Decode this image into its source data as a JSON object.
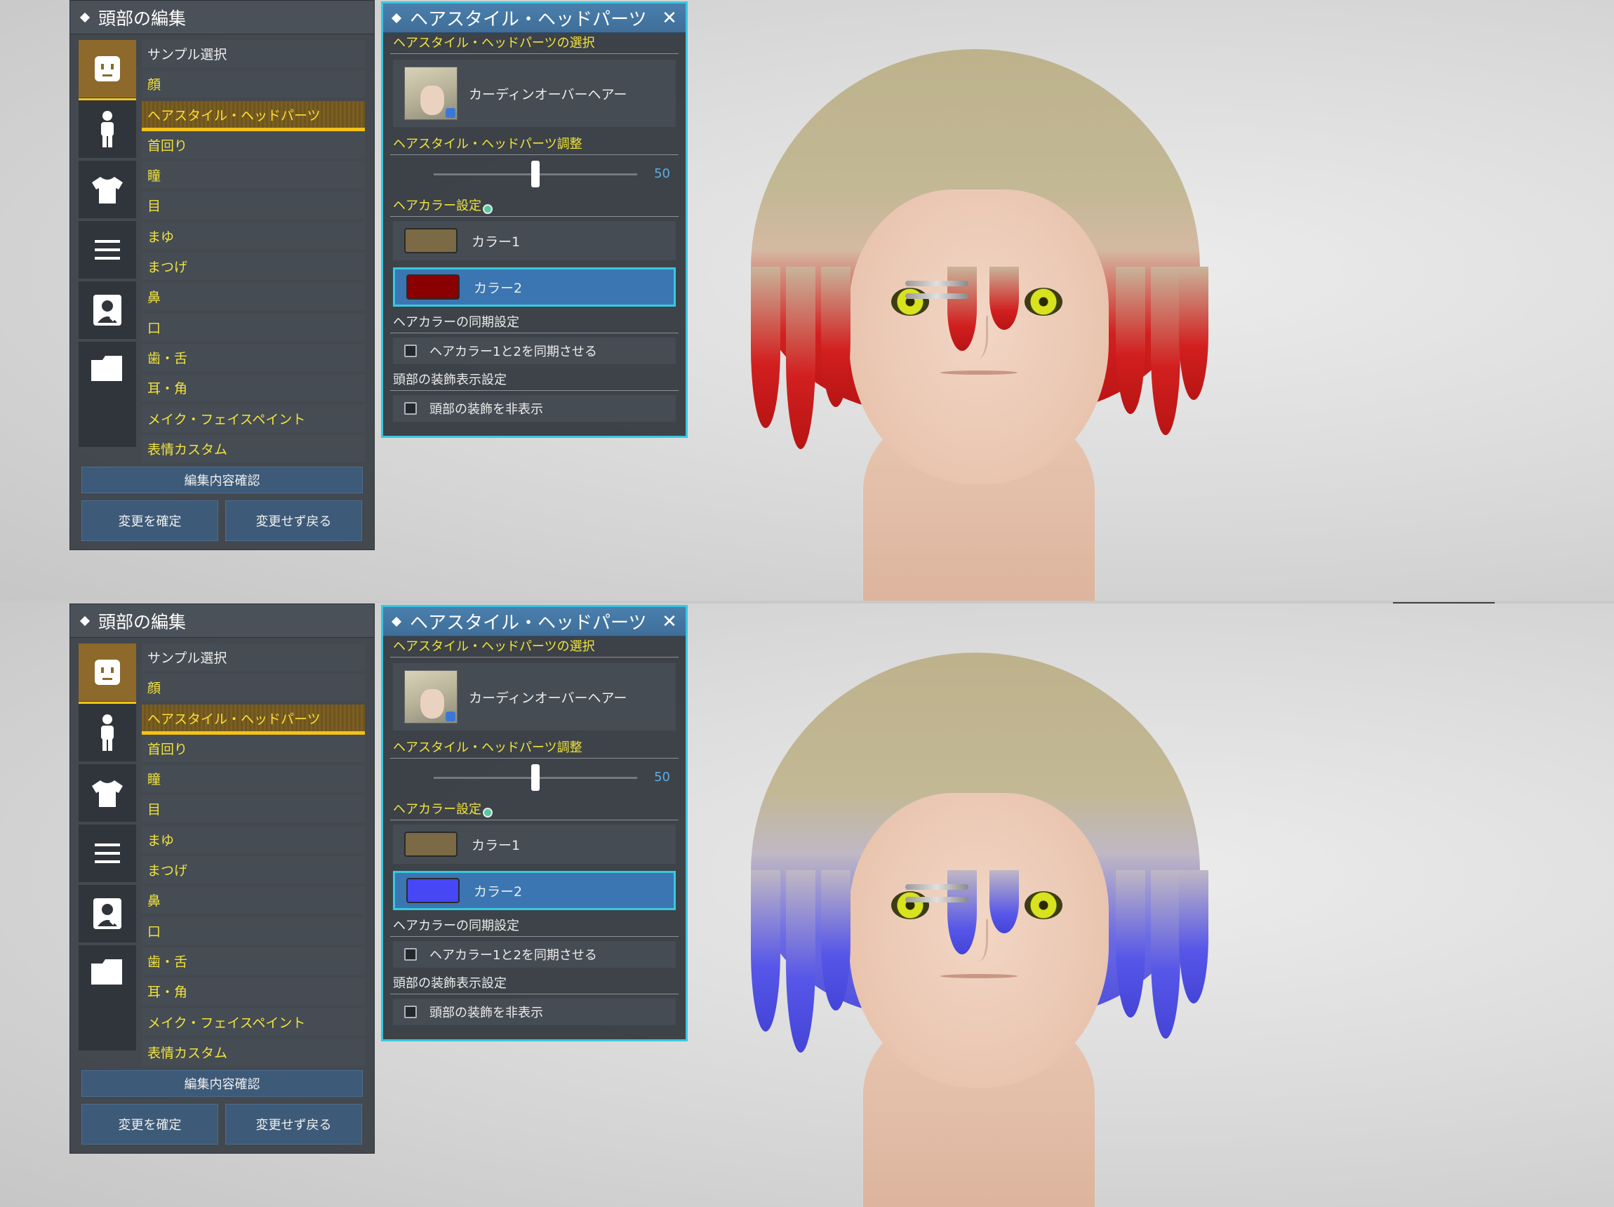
{
  "edit_panel": {
    "title": "頭部の編集",
    "menu": [
      {
        "label": "サンプル選択",
        "style": "white"
      },
      {
        "label": "顔",
        "style": "yellow"
      },
      {
        "label": "ヘアスタイル・ヘッドパーツ",
        "style": "selected"
      },
      {
        "label": "首回り",
        "style": "yellow"
      },
      {
        "label": "瞳",
        "style": "yellow"
      },
      {
        "label": "目",
        "style": "yellow"
      },
      {
        "label": "まゆ",
        "style": "yellow"
      },
      {
        "label": "まつげ",
        "style": "yellow"
      },
      {
        "label": "鼻",
        "style": "yellow"
      },
      {
        "label": "口",
        "style": "yellow"
      },
      {
        "label": "歯・舌",
        "style": "yellow"
      },
      {
        "label": "耳・角",
        "style": "yellow"
      },
      {
        "label": "メイク・フェイスペイント",
        "style": "yellow"
      },
      {
        "label": "表情カスタム",
        "style": "yellow"
      }
    ],
    "icons": [
      "face-icon",
      "body-icon",
      "shirt-icon",
      "list-icon",
      "profile-icon",
      "folder-icon"
    ],
    "review_button": "編集内容確認",
    "apply_button": "変更を確定",
    "back_button": "変更せず戻る"
  },
  "hair_panel": {
    "title": "ヘアスタイル・ヘッドパーツ",
    "close_glyph": "✕",
    "select_section": "ヘアスタイル・ヘッドパーツの選択",
    "hair_name": "カーディンオーバーヘアー",
    "adjust_section": "ヘアスタイル・ヘッドパーツ調整",
    "slider_value": 50,
    "slider_label": "50",
    "color_section": "ヘアカラー設定",
    "color1_label": "カラー1",
    "color2_label": "カラー2",
    "color1": "#7b6a45",
    "sync_section": "ヘアカラーの同期設定",
    "sync_checkbox": "ヘアカラー1と2を同期させる",
    "sync_checked": false,
    "deco_section": "頭部の装飾表示設定",
    "deco_checkbox": "頭部の装飾を非表示",
    "deco_checked": false
  },
  "variants": [
    {
      "color2": "#8a0000",
      "hair_tip": "#d21f1f"
    },
    {
      "color2": "#4747f5",
      "hair_tip": "#5656e8"
    }
  ],
  "hair_base_color": "#bdb28c"
}
